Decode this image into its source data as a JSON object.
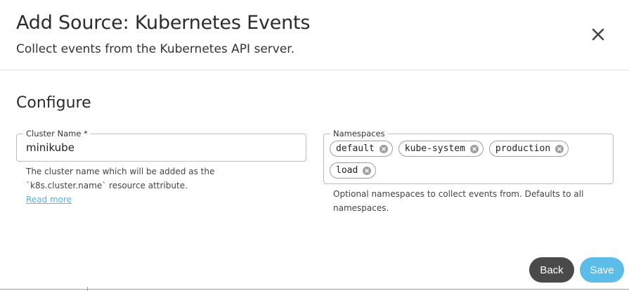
{
  "dialog": {
    "title": "Add Source: Kubernetes Events",
    "subtitle": "Collect events from the Kubernetes API server.",
    "close_icon": "close-icon"
  },
  "configure": {
    "section_title": "Configure",
    "cluster_name": {
      "label": "Cluster Name *",
      "value": "minikube",
      "helper": "The cluster name which will be added as the `k8s.cluster.name` resource attribute.",
      "link": "Read more"
    },
    "namespaces": {
      "label": "Namespaces",
      "chips": [
        "default",
        "kube-system",
        "production",
        "load"
      ],
      "helper": "Optional namespaces to collect events from. Defaults to all namespaces."
    }
  },
  "actions": {
    "back": "Back",
    "save": "Save"
  },
  "colors": {
    "save_button": "#5cbde8",
    "back_button": "#4a4a4a",
    "link": "#4fb4e8"
  }
}
